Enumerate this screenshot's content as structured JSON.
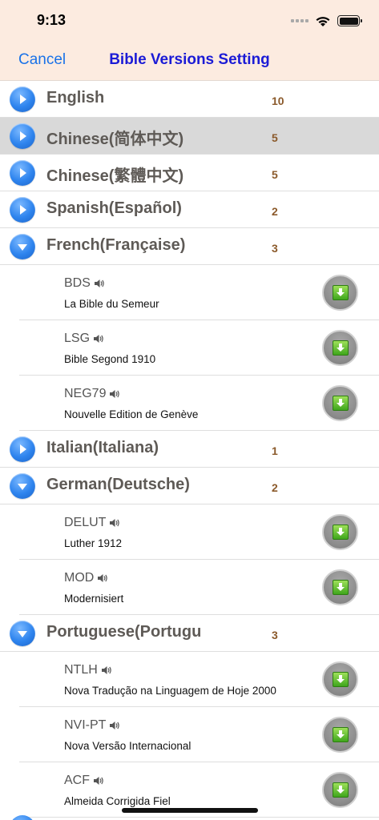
{
  "status_bar": {
    "time": "9:13"
  },
  "nav": {
    "cancel_label": "Cancel",
    "title": "Bible Versions Setting"
  },
  "rows": [
    {
      "kind": "language",
      "name": "English",
      "count": "10",
      "expanded": false,
      "selected": false
    },
    {
      "kind": "language",
      "name": "Chinese(简体中文)",
      "count": "5",
      "expanded": false,
      "selected": true
    },
    {
      "kind": "language",
      "name": "Chinese(繁體中文)",
      "count": "5",
      "expanded": false,
      "selected": false
    },
    {
      "kind": "language",
      "name": "Spanish(Español)",
      "count": "2",
      "expanded": false,
      "selected": false
    },
    {
      "kind": "language",
      "name": "French(Française)",
      "count": "3",
      "expanded": true,
      "selected": false
    },
    {
      "kind": "version",
      "code": "BDS",
      "name": "La Bible du Semeur",
      "audio": true
    },
    {
      "kind": "version",
      "code": "LSG",
      "name": "Bible Segond 1910",
      "audio": true
    },
    {
      "kind": "version",
      "code": "NEG79",
      "name": "Nouvelle Edition de Genève",
      "audio": true
    },
    {
      "kind": "language",
      "name": "Italian(Italiana)",
      "count": "1",
      "expanded": false,
      "selected": false
    },
    {
      "kind": "language",
      "name": "German(Deutsche)",
      "count": "2",
      "expanded": true,
      "selected": false
    },
    {
      "kind": "version",
      "code": "DELUT",
      "name": "Luther 1912",
      "audio": true
    },
    {
      "kind": "version",
      "code": "MOD",
      "name": "Modernisiert",
      "audio": true
    },
    {
      "kind": "language",
      "name": "Portuguese(Portugu",
      "count": "3",
      "expanded": true,
      "selected": false
    },
    {
      "kind": "version",
      "code": "NTLH",
      "name": "Nova Tradução na Linguagem de Hoje 2000",
      "audio": true
    },
    {
      "kind": "version",
      "code": "NVI-PT",
      "name": "Nova Versão Internacional",
      "audio": true
    },
    {
      "kind": "version",
      "code": "ACF",
      "name": "Almeida Corrigida Fiel",
      "audio": true
    }
  ],
  "icons": {
    "collapsed": "chevron-right-icon",
    "expanded": "chevron-down-icon",
    "audio": "speaker-icon",
    "download": "download-icon"
  },
  "colors": {
    "header_bg": "#fcebe0",
    "title": "#1b1bd6",
    "cancel": "#1a72e8",
    "count": "#8b5a2b",
    "selected_row": "#d9d9d9",
    "arrow_button": "#2e84ee",
    "download_green": "#5cc22a"
  }
}
